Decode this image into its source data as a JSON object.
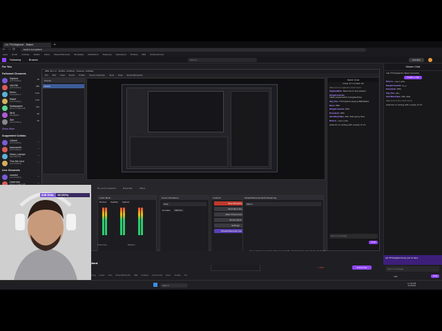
{
  "browser": {
    "tab_title": "(3) TTV/Vigilant - Twitch",
    "address": "twitch.tv/vigilant",
    "bookmarks": [
      "Apps",
      "Gmail",
      "YouTube",
      "Twitter",
      "Alerts",
      "StreamElements",
      "Templates",
      "Multitwitch",
      "Teleparty",
      "Dashboard",
      "Emotes",
      "OBS",
      "All Bookmarks"
    ]
  },
  "twitch": {
    "nav_following": "Following",
    "nav_browse": "Browse",
    "search_placeholder": "Search",
    "get_bits": "Get Bits",
    "sidebar": {
      "for_you": "For You",
      "followed_title": "Followed Channels",
      "followed": [
        {
          "name": "Vigilant",
          "game": "Just Chatting",
          "viewers": "1K"
        },
        {
          "name": "xQcOW",
          "game": "Just Chatting",
          "viewers": "38K"
        },
        {
          "name": "Emiru",
          "game": "Overwatch 2",
          "viewers": "6.2K"
        },
        {
          "name": "Mizkif",
          "game": "Just Chatting",
          "viewers": "4.1K"
        },
        {
          "name": "Sodapoppin",
          "game": "World of Warcraft",
          "viewers": "12K"
        },
        {
          "name": "Tarik",
          "game": "VALORANT",
          "viewers": "9K"
        },
        {
          "name": "Zoil",
          "game": "Just Chatting",
          "viewers": "2K"
        }
      ],
      "show_more": "Show More",
      "suggested_title": "Suggested Collabs",
      "suggested": [
        {
          "name": "vilAmir",
          "game": "Just Chatting",
          "viewers": "—"
        },
        {
          "name": "Jasonsmith",
          "game": "Just Chatting",
          "viewers": "—"
        },
        {
          "name": "Vision_Lestiph",
          "game": "Hear Me Out",
          "viewers": "—"
        },
        {
          "name": "Tino the Lynx",
          "game": "Just Chatting",
          "viewers": "—"
        }
      ],
      "live_title": "Live Channels",
      "live": [
        {
          "name": "xaadari",
          "game": "Just Chatting",
          "viewers": "—"
        },
        {
          "name": "Lasercow",
          "game": "World of Warcraft",
          "viewers": "—"
        },
        {
          "name": "vilAmir",
          "game": "Just Chatting",
          "viewers": "—"
        }
      ]
    },
    "goal_label": "SUB GOAL",
    "goal_text": "16 (32%)",
    "goal_percent": 32
  },
  "obs": {
    "title": "OBS 30.1.2 - Profile: Untitled - Scenes: Untitled",
    "menu": [
      "File",
      "Edit",
      "View",
      "Docks",
      "Profile",
      "Scene Collection",
      "Tools",
      "Help",
      "StreamElements"
    ],
    "scenes_title": "Scenes",
    "scene_item": "Scene",
    "no_source_selected": "No source selected",
    "properties": "Properties",
    "filters": "Filters",
    "audio_mixer_title": "Audio Mixer",
    "audio_channels": [
      "Mic/Aux",
      "Desktop",
      "Capture"
    ],
    "transitions_title": "Scene Transitions",
    "transition_value": "Fade",
    "duration_label": "Duration",
    "duration_value": "300 ms",
    "controls_title": "Controls",
    "controls": [
      "Stop Streaming",
      "Start Recording",
      "Start Virtual Camera",
      "Studio Mode",
      "Settings"
    ],
    "support_label": "StreamElements Live Support",
    "multistream_title": "StreamElements Multi-Streaming",
    "multistream_item": "Twitch",
    "status_text": "Dropped Frames 0 (0.0%)   LIVE: 02:14:07   REC: 00:00:00   CPU: 3.6%   60.00 / 60.00 FPS",
    "sources_label": "0 Sources",
    "options_label": "Options"
  },
  "obs_chat": {
    "title": "Twitch Chat",
    "viewer_note": "Cheer ♦ 1 to take 1st",
    "welcome": "Welcome to vigilant's chat room!",
    "messages": [
      {
        "user": "VigilantBot",
        "text": "Welcome to the stream!"
      },
      {
        "user": "KingArmando",
        "text": "https://www.twitch.tv/vigilant/clip"
      },
      {
        "user": "Vig_Fan",
        "text": "TTV/Vigilant playing Battlefield"
      },
      {
        "user": "Nora",
        "text": "NPC"
      },
      {
        "user": "KingArmando",
        "text": "RPG"
      },
      {
        "user": "Emedeck",
        "text": "RPG"
      },
      {
        "user": "AlexHasClips",
        "text": "stan deal going here"
      },
      {
        "user": "Noura",
        "text": "سلام يا شباب"
      }
    ],
    "raid_note": "Abandon is raiding with a party of 13.",
    "input_placeholder": "Send a message",
    "send_label": "Chat"
  },
  "twitch_chat": {
    "title": "Stream Chat",
    "clip_line": "Clip TTV/Vigilant's latest moments",
    "create_clip": "Create a Clip",
    "messages": [
      {
        "user": "Noura",
        "text": "سلام يا شباب"
      },
      {
        "user": "KingArmando",
        "text": "مرحبا"
      },
      {
        "user": "Emedeck",
        "text": "RPG"
      },
      {
        "user": "Vig_Fan",
        "text": "سلام"
      },
      {
        "user": "AlexHasClips",
        "text": "stan deal"
      }
    ],
    "welcome": "Welcome to the chat room!",
    "raid_note": "Abandon is raiding with a party of 13.",
    "raid_banner": "Let TTV/Vigilant know you're here",
    "input_placeholder": "Send a message",
    "points": "100",
    "send_label": "Chat"
  },
  "stream_info": {
    "channel": "TTV/Vigilant",
    "title": "Just Chatting / Reacting to OBS",
    "category": "Just Chatting",
    "subscribe": "Subscribe",
    "viewers": "1,056",
    "uptime": "2:14:07",
    "tags": [
      "English",
      "Gaming",
      "Arabic",
      "Chill",
      "StreamElements",
      "OBS",
      "Creative",
      "Community",
      "Music",
      "Variety",
      "Fun"
    ]
  },
  "taskbar": {
    "search_placeholder": "Search",
    "time": "11:42 PM",
    "date": "4/3/2024"
  }
}
